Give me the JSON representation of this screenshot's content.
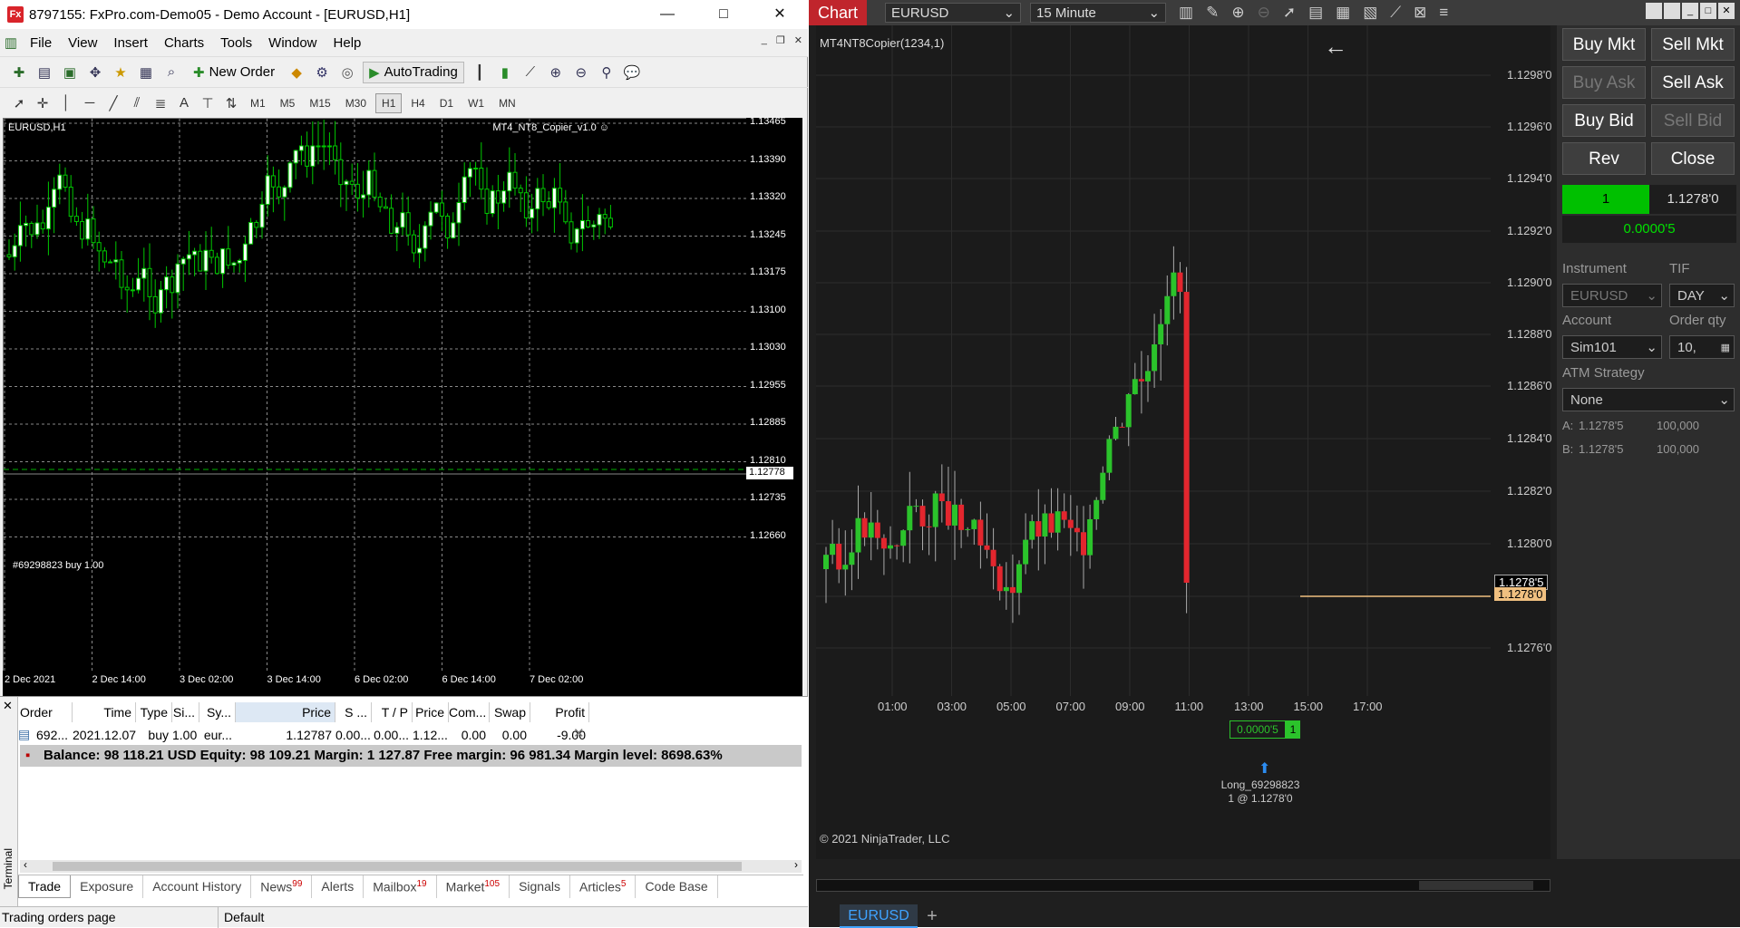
{
  "mt4": {
    "title": "8797155: FxPro.com-Demo05 - Demo Account - [EURUSD,H1]",
    "app_icon": "Fx",
    "window_controls": {
      "minimize": "—",
      "maximize": "□",
      "close": "✕"
    },
    "menu": [
      "File",
      "View",
      "Insert",
      "Charts",
      "Tools",
      "Window",
      "Help"
    ],
    "toolbar": {
      "new_order": "New Order",
      "autotrading": "AutoTrading"
    },
    "drawing_tools": {
      "text": "A"
    },
    "timeframes": [
      "M1",
      "M5",
      "M15",
      "M30",
      "H1",
      "H4",
      "D1",
      "W1",
      "MN"
    ],
    "selected_timeframe": "H1",
    "chart": {
      "symbol_label": "EURUSD,H1",
      "ea_name": "MT4_NT8_Copier_v1.0 ☺",
      "order_line_label": "#69298823 buy 1.00",
      "current_price": "1.12778",
      "y_ticks": [
        "1.13465",
        "1.13390",
        "1.13320",
        "1.13245",
        "1.13175",
        "1.13100",
        "1.13030",
        "1.12955",
        "1.12885",
        "1.12810",
        "1.12735",
        "1.12660"
      ],
      "x_ticks": [
        "2 Dec 2021",
        "2 Dec 14:00",
        "3 Dec 02:00",
        "3 Dec 14:00",
        "6 Dec 02:00",
        "6 Dec 14:00",
        "7 Dec 02:00"
      ]
    },
    "terminal": {
      "label": "Terminal",
      "columns": [
        "Order",
        "Time",
        "Type",
        "Si...",
        "Sy...",
        "Price",
        "S ...",
        "T / P",
        "Price",
        "Com...",
        "Swap",
        "Profit"
      ],
      "row": [
        "692...",
        "2021.12.07 ...",
        "buy",
        "1.00",
        "eur...",
        "1.12787",
        "0.00...",
        "0.00...",
        "1.12...",
        "0.00",
        "0.00",
        "-9.00"
      ],
      "balance": "Balance: 98 118.21 USD  Equity: 98 109.21  Margin: 1 127.87  Free margin: 96 981.34  Margin level: 8698.63%",
      "tabs": [
        {
          "label": "Trade",
          "badge": ""
        },
        {
          "label": "Exposure",
          "badge": ""
        },
        {
          "label": "Account History",
          "badge": ""
        },
        {
          "label": "News",
          "badge": "99"
        },
        {
          "label": "Alerts",
          "badge": ""
        },
        {
          "label": "Mailbox",
          "badge": "19"
        },
        {
          "label": "Market",
          "badge": "105"
        },
        {
          "label": "Signals",
          "badge": ""
        },
        {
          "label": "Articles",
          "badge": "5"
        },
        {
          "label": "Code Base",
          "badge": ""
        }
      ]
    },
    "status": {
      "left": "Trading orders page",
      "profile": "Default"
    }
  },
  "nt": {
    "chart_tab": "Chart",
    "instrument": "EURUSD",
    "interval": "15 Minute",
    "indicator_label": "MT4NT8Copier(1234,1)",
    "copyright": "© 2021 NinjaTrader, LLC",
    "y_ticks": [
      "1.1298'0",
      "1.1296'0",
      "1.1294'0",
      "1.1292'0",
      "1.1290'0",
      "1.1288'0",
      "1.1286'0",
      "1.1284'0",
      "1.1282'0",
      "1.1280'0",
      "1.1278'5",
      "1.1278'0",
      "1.1276'0"
    ],
    "x_ticks": [
      "01:00",
      "03:00",
      "05:00",
      "07:00",
      "09:00",
      "11:00",
      "13:00",
      "15:00",
      "17:00"
    ],
    "position_pnl": "0.0000'5",
    "position_qty": "1",
    "execution_label": "Long_69298823",
    "execution_fill": "1 @ 1.1278'0",
    "bottom_tab": "EURUSD",
    "add_tab": "+",
    "back_arrow": "←",
    "chart_trader": {
      "buy_mkt": "Buy Mkt",
      "sell_mkt": "Sell Mkt",
      "buy_ask": "Buy Ask",
      "sell_ask": "Sell Ask",
      "buy_bid": "Buy Bid",
      "sell_bid": "Sell Bid",
      "rev": "Rev",
      "close": "Close",
      "pos_qty": "1",
      "pos_price": "1.1278'0",
      "unrealized": "0.0000'5",
      "instrument_label": "Instrument",
      "instrument_value": "EURUSD",
      "tif_label": "TIF",
      "tif_value": "DAY",
      "account_label": "Account",
      "account_value": "Sim101",
      "qty_label": "Order qty",
      "qty_value": "10,",
      "atm_label": "ATM Strategy",
      "atm_value": "None",
      "ask_row": {
        "label": "A:",
        "price": "1.1278'5",
        "size": "100,000"
      },
      "bid_row": {
        "label": "B:",
        "price": "1.1278'5",
        "size": "100,000"
      }
    },
    "colors": {
      "up": "#2bc32b",
      "down": "#e3262e",
      "accent": "#00c000"
    }
  }
}
